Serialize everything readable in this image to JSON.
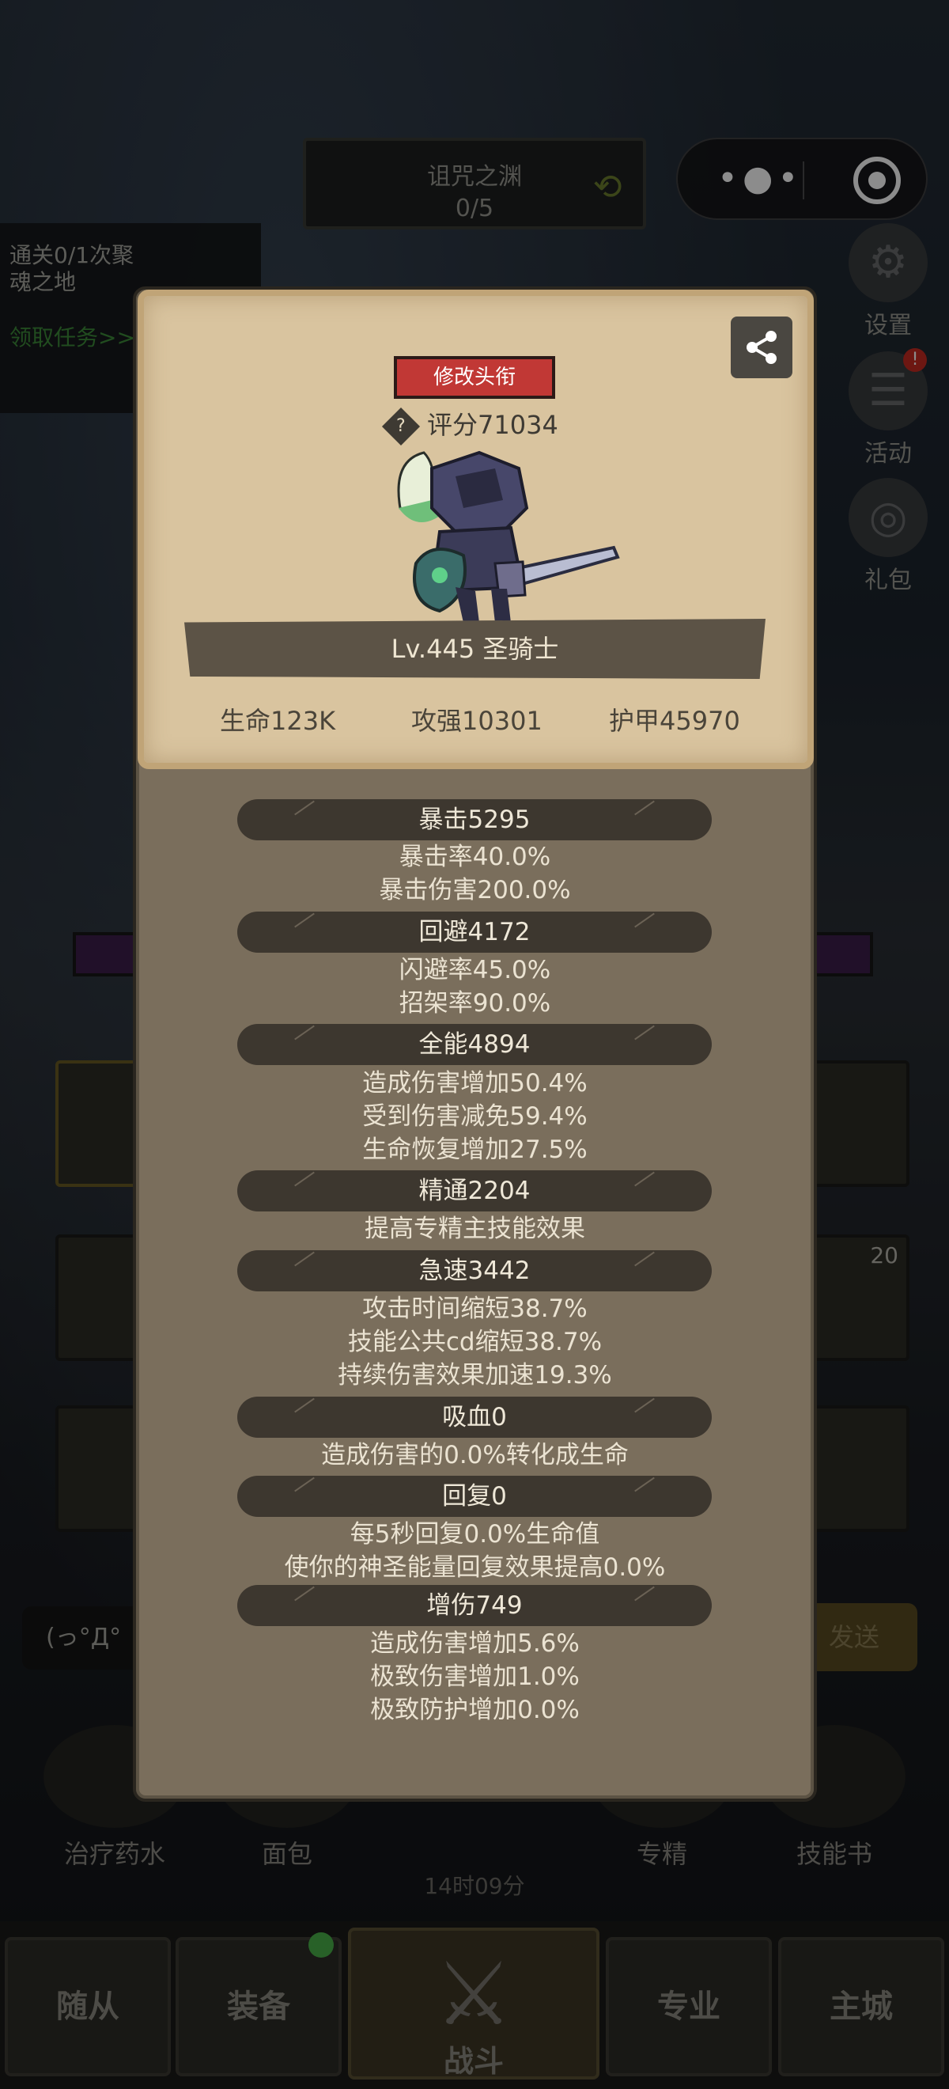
{
  "header": {
    "stage_name": "诅咒之渊",
    "stage_progress": "0/5"
  },
  "quest": {
    "text": "通关0/1次聚魂之地",
    "link": "领取任务>>"
  },
  "side_menu": [
    {
      "label": "设置"
    },
    {
      "label": "活动",
      "badge": "!"
    },
    {
      "label": "礼包"
    }
  ],
  "card": {
    "title_button": "修改头衔",
    "score": "评分71034",
    "level_class": "Lv.445 圣骑士",
    "attributes": [
      "生命123K",
      "攻强10301",
      "护甲45970"
    ]
  },
  "stats": [
    {
      "header": "暴击5295",
      "lines": [
        "暴击率40.0%",
        "暴击伤害200.0%"
      ]
    },
    {
      "header": "回避4172",
      "lines": [
        "闪避率45.0%",
        "招架率90.0%"
      ]
    },
    {
      "header": "全能4894",
      "lines": [
        "造成伤害增加50.4%",
        "受到伤害减免59.4%",
        "生命恢复增加27.5%"
      ]
    },
    {
      "header": "精通2204",
      "lines": [
        "提高专精主技能效果"
      ]
    },
    {
      "header": "急速3442",
      "lines": [
        "攻击时间缩短38.7%",
        "技能公共cd缩短38.7%",
        "持续伤害效果加速19.3%"
      ]
    },
    {
      "header": "吸血0",
      "lines": [
        "造成伤害的0.0%转化成生命"
      ]
    },
    {
      "header": "回复0",
      "lines": [
        "每5秒回复0.0%生命值",
        "使你的神圣能量回复效果提高0.0%"
      ]
    },
    {
      "header": "增伤749",
      "lines": [
        "造成伤害增加5.6%",
        "极致伤害增加1.0%",
        "极致防护增加0.0%"
      ]
    }
  ],
  "background": {
    "chat_placeholder": "(っ°Д°",
    "send_label": "发送",
    "tools": [
      "治疗药水",
      "面包",
      "专精",
      "技能书"
    ],
    "timer": "14时09分",
    "slot_count_label": "20"
  },
  "nav": [
    "随从",
    "装备",
    "战斗",
    "专业",
    "主城"
  ],
  "colors": {
    "title_button": "#c13835",
    "card_parchment": "#d9c49f",
    "modal_body": "#7a6e5c",
    "banner": "#3d372f"
  }
}
